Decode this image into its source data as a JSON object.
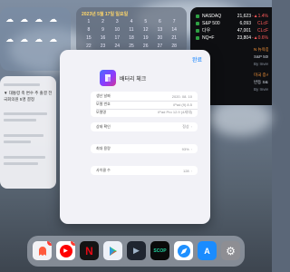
{
  "calendar": {
    "title": "2023년 5월 17일 일요일",
    "days": [
      "1",
      "2",
      "3",
      "4",
      "5",
      "6",
      "7",
      "8",
      "9",
      "10",
      "11",
      "12",
      "13",
      "14",
      "15",
      "16",
      "17",
      "18",
      "19",
      "20",
      "21",
      "22",
      "23",
      "24",
      "25",
      "26",
      "27",
      "28"
    ]
  },
  "stocks": [
    {
      "name": "NASDAQ",
      "price": "21,623",
      "change": "-▲1.4%"
    },
    {
      "name": "S&P 500",
      "price": "6,093",
      "change": "CLcF"
    },
    {
      "name": "다우",
      "price": "47,001",
      "change": "CLcF"
    },
    {
      "name": "NQ=F",
      "price": "23,804",
      "change": "-▲0.6%"
    }
  ],
  "news": {
    "headline_1": "N 뉴욕증시, 5.4%오르며",
    "headline_2": "S&P 500 역대 최고치",
    "source_1": "By Investing.com",
    "headline_3": "미국 증시, S&P 500 주가 방향",
    "headline_4": "반등 S&P 500지수 마감",
    "source_2": "By Investing.com"
  },
  "left_news": {
    "line_1": "▼ 대통령 축 변수 추 출결 전",
    "line_2": "국회의원 5명 결정"
  },
  "modal": {
    "done_label": "완료",
    "app_name": "배터리 체크",
    "rows": [
      {
        "label": "생산 날짜",
        "value": "2020. 08. 10"
      },
      {
        "label": "모델 번호",
        "value": "iPad (9) 8.5"
      },
      {
        "label": "모델명",
        "value": "iPad Pro 12.9 (4세대)"
      },
      {
        "label": "상태 확인",
        "value": "정상"
      },
      {
        "label": "최대 용량",
        "value": "93%"
      },
      {
        "label": "사이클 수",
        "value": "128"
      }
    ]
  },
  "dock": {
    "badge_first": "1",
    "badge_youtube": "1",
    "netflix_letter": "N",
    "play_glyph": "▶",
    "scop_label": "SCOP",
    "appstore_glyph": "A",
    "settings_glyph": "⚙"
  },
  "colors": {
    "accent": "#007aff",
    "badge_red": "#ff3b30",
    "netflix_red": "#e50914",
    "stocks_down": "#ff5a5a"
  }
}
